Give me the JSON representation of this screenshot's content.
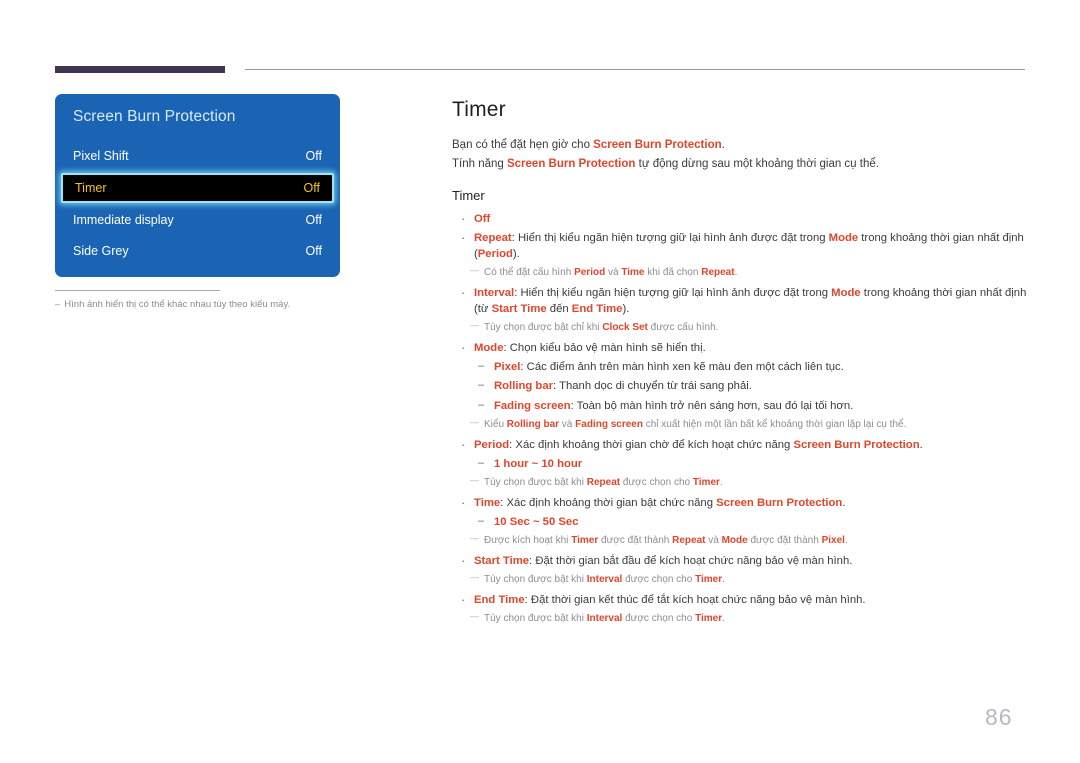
{
  "header": {
    "rule_dark_color": "#3f3550",
    "rule_thin_color": "#9a9a9a"
  },
  "osd": {
    "title": "Screen Burn Protection",
    "panel_color": "#1b63b3",
    "highlight_text_color": "#f5c518",
    "highlight_border_color": "#9fe4f5",
    "rows": [
      {
        "label": "Pixel Shift",
        "value": "Off",
        "selected": false
      },
      {
        "label": "Timer",
        "value": "Off",
        "selected": true
      },
      {
        "label": "Immediate display",
        "value": "Off",
        "selected": false
      },
      {
        "label": "Side Grey",
        "value": "Off",
        "selected": false
      }
    ]
  },
  "caption": {
    "dash": "–",
    "text": "Hình ảnh hiển thị có thể khác nhau tùy theo kiểu máy."
  },
  "main": {
    "title": "Timer",
    "accent_color": "#e0462b",
    "intro": [
      {
        "parts": [
          {
            "t": "Bạn có thể đặt hẹn giờ cho ",
            "s": "plain"
          },
          {
            "t": "Screen Burn Protection",
            "s": "accent"
          },
          {
            "t": ".",
            "s": "plain"
          }
        ]
      },
      {
        "parts": [
          {
            "t": "Tính năng ",
            "s": "plain"
          },
          {
            "t": "Screen Burn Protection",
            "s": "accent"
          },
          {
            "t": " tự động dừng sau một khoảng thời gian cụ thể.",
            "s": "plain"
          }
        ]
      }
    ],
    "section_title": "Timer",
    "items": [
      {
        "kind": "bullet",
        "parts": [
          {
            "t": "Off",
            "s": "accent"
          }
        ]
      },
      {
        "kind": "bullet",
        "parts": [
          {
            "t": "Repeat",
            "s": "accent"
          },
          {
            "t": ": Hiển thị kiểu ngăn hiện tượng giữ lại hình ảnh được đặt trong ",
            "s": "plain"
          },
          {
            "t": "Mode",
            "s": "accent"
          },
          {
            "t": " trong khoảng thời gian nhất định (",
            "s": "plain"
          },
          {
            "t": "Period",
            "s": "accent"
          },
          {
            "t": ").",
            "s": "plain"
          }
        ]
      },
      {
        "kind": "note",
        "parts": [
          {
            "t": "Có thể đặt cấu hình ",
            "s": "plain"
          },
          {
            "t": "Period",
            "s": "accent"
          },
          {
            "t": " và ",
            "s": "plain"
          },
          {
            "t": "Time",
            "s": "accent"
          },
          {
            "t": " khi đã chọn ",
            "s": "plain"
          },
          {
            "t": "Repeat",
            "s": "accent"
          },
          {
            "t": ".",
            "s": "plain"
          }
        ]
      },
      {
        "kind": "bullet",
        "parts": [
          {
            "t": "Interval",
            "s": "accent"
          },
          {
            "t": ": Hiển thị kiểu ngăn hiện tượng giữ lại hình ảnh được đặt trong ",
            "s": "plain"
          },
          {
            "t": "Mode",
            "s": "accent"
          },
          {
            "t": " trong khoảng thời gian nhất định (từ ",
            "s": "plain"
          },
          {
            "t": "Start Time",
            "s": "accent"
          },
          {
            "t": " đến ",
            "s": "plain"
          },
          {
            "t": "End Time",
            "s": "accent"
          },
          {
            "t": ").",
            "s": "plain"
          }
        ]
      },
      {
        "kind": "note",
        "parts": [
          {
            "t": "Tùy chọn được bật chỉ khi ",
            "s": "plain"
          },
          {
            "t": "Clock Set",
            "s": "accent"
          },
          {
            "t": " được cấu hình.",
            "s": "plain"
          }
        ]
      },
      {
        "kind": "bullet",
        "parts": [
          {
            "t": "Mode",
            "s": "accent"
          },
          {
            "t": ": Chọn kiểu bảo vệ màn hình sẽ hiển thị.",
            "s": "plain"
          }
        ]
      },
      {
        "kind": "sub",
        "parts": [
          {
            "t": "Pixel",
            "s": "accent"
          },
          {
            "t": ": Các điểm ảnh trên màn hình xen kẽ màu đen một cách liên tục.",
            "s": "plain"
          }
        ]
      },
      {
        "kind": "sub",
        "parts": [
          {
            "t": "Rolling bar",
            "s": "accent"
          },
          {
            "t": ": Thanh dọc di chuyển từ trái sang phải.",
            "s": "plain"
          }
        ]
      },
      {
        "kind": "sub",
        "parts": [
          {
            "t": "Fading screen",
            "s": "accent"
          },
          {
            "t": ": Toàn bộ màn hình trở nên sáng hơn, sau đó lại tối hơn.",
            "s": "plain"
          }
        ]
      },
      {
        "kind": "note",
        "parts": [
          {
            "t": "Kiểu ",
            "s": "plain"
          },
          {
            "t": "Rolling bar",
            "s": "accent"
          },
          {
            "t": " và ",
            "s": "plain"
          },
          {
            "t": "Fading screen",
            "s": "accent"
          },
          {
            "t": " chỉ xuất hiện một lần bất kể khoảng thời gian lặp lại cụ thể.",
            "s": "plain"
          }
        ]
      },
      {
        "kind": "bullet",
        "parts": [
          {
            "t": "Period",
            "s": "accent"
          },
          {
            "t": ": Xác định khoảng thời gian chờ để kích hoạt chức năng ",
            "s": "plain"
          },
          {
            "t": "Screen Burn Protection",
            "s": "accent"
          },
          {
            "t": ".",
            "s": "plain"
          }
        ]
      },
      {
        "kind": "sub",
        "parts": [
          {
            "t": "1 hour ~ 10 hour",
            "s": "accent"
          }
        ]
      },
      {
        "kind": "note",
        "parts": [
          {
            "t": "Tùy chọn được bật khi ",
            "s": "plain"
          },
          {
            "t": "Repeat",
            "s": "accent"
          },
          {
            "t": " được chọn cho ",
            "s": "plain"
          },
          {
            "t": "Timer",
            "s": "accent"
          },
          {
            "t": ".",
            "s": "plain"
          }
        ]
      },
      {
        "kind": "bullet",
        "parts": [
          {
            "t": "Time",
            "s": "accent"
          },
          {
            "t": ": Xác định khoảng thời gian bật chức năng ",
            "s": "plain"
          },
          {
            "t": "Screen Burn Protection",
            "s": "accent"
          },
          {
            "t": ".",
            "s": "plain"
          }
        ]
      },
      {
        "kind": "sub",
        "parts": [
          {
            "t": "10 Sec ~ 50 Sec",
            "s": "accent"
          }
        ]
      },
      {
        "kind": "note",
        "parts": [
          {
            "t": "Được kích hoạt khi ",
            "s": "plain"
          },
          {
            "t": "Timer",
            "s": "accent"
          },
          {
            "t": " được đặt thành ",
            "s": "plain"
          },
          {
            "t": "Repeat",
            "s": "accent"
          },
          {
            "t": " và ",
            "s": "plain"
          },
          {
            "t": "Mode",
            "s": "accent"
          },
          {
            "t": " được đặt thành ",
            "s": "plain"
          },
          {
            "t": "Pixel",
            "s": "accent"
          },
          {
            "t": ".",
            "s": "plain"
          }
        ]
      },
      {
        "kind": "bullet",
        "parts": [
          {
            "t": "Start Time",
            "s": "accent"
          },
          {
            "t": ": Đặt thời gian bắt đầu để kích hoạt chức năng bảo vệ màn hình.",
            "s": "plain"
          }
        ]
      },
      {
        "kind": "note",
        "parts": [
          {
            "t": "Tùy chọn được bật khi ",
            "s": "plain"
          },
          {
            "t": "Interval",
            "s": "accent"
          },
          {
            "t": " được chọn cho ",
            "s": "plain"
          },
          {
            "t": "Timer",
            "s": "accent"
          },
          {
            "t": ".",
            "s": "plain"
          }
        ]
      },
      {
        "kind": "bullet",
        "parts": [
          {
            "t": "End Time",
            "s": "accent"
          },
          {
            "t": ": Đặt thời gian kết thúc để tắt kích hoạt chức năng bảo vệ màn hình.",
            "s": "plain"
          }
        ]
      },
      {
        "kind": "note",
        "parts": [
          {
            "t": "Tùy chọn được bật khi ",
            "s": "plain"
          },
          {
            "t": "Interval",
            "s": "accent"
          },
          {
            "t": " được chọn cho ",
            "s": "plain"
          },
          {
            "t": "Timer",
            "s": "accent"
          },
          {
            "t": ".",
            "s": "plain"
          }
        ]
      }
    ]
  },
  "footer": {
    "page_number": "86"
  }
}
